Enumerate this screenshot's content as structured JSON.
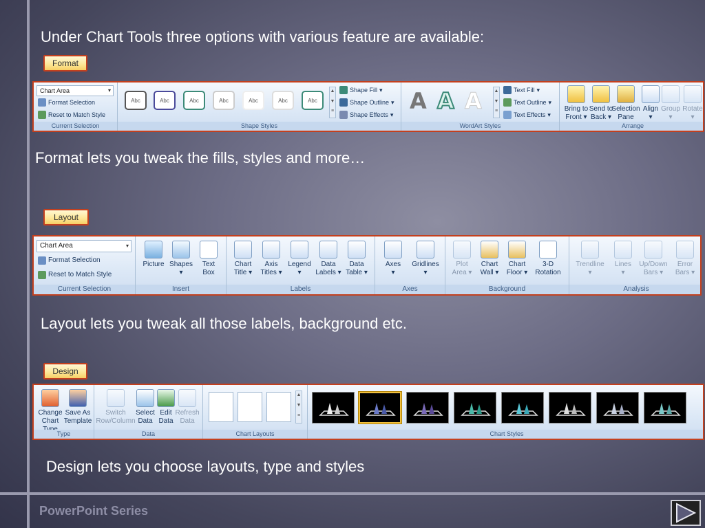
{
  "headings": {
    "intro": "Under Chart Tools three options with various feature are available:",
    "format_desc": "Format lets you tweak the fills, styles and more…",
    "layout_desc": "Layout lets you tweak all those labels, background etc.",
    "design_desc": "Design lets you choose layouts, type and styles"
  },
  "footer": "PowerPoint Series",
  "tabs": {
    "format": "Format",
    "layout": "Layout",
    "design": "Design"
  },
  "colors": {
    "tab_border": "#c4401e",
    "ribbon_label": "#3b5a82",
    "footer_text": "#8e8ea6"
  },
  "format_ribbon": {
    "chart_area": "Chart Area",
    "format_selection": "Format Selection",
    "reset_to_match_style": "Reset to Match Style",
    "current_selection": "Current Selection",
    "shape_swatch": "Abc",
    "shape_fill": "Shape Fill",
    "shape_outline": "Shape Outline",
    "shape_effects": "Shape Effects",
    "shape_styles": "Shape Styles",
    "wordart_letter": "A",
    "text_fill": "Text Fill",
    "text_outline": "Text Outline",
    "text_effects": "Text Effects",
    "wordart_styles": "WordArt Styles",
    "bring_to_front": [
      "Bring to",
      "Front ▾"
    ],
    "send_to_back": [
      "Send to",
      "Back ▾"
    ],
    "selection_pane": [
      "Selection",
      "Pane"
    ],
    "align": [
      "Align",
      "▾"
    ],
    "group": [
      "Group",
      "▾"
    ],
    "rotate": [
      "Rotate",
      "▾"
    ],
    "arrange": "Arrange"
  },
  "layout_ribbon": {
    "chart_area": "Chart Area",
    "format_selection": "Format Selection",
    "reset_to_match_style": "Reset to Match Style",
    "current_selection": "Current Selection",
    "picture": "Picture",
    "shapes": [
      "Shapes",
      "▾"
    ],
    "text_box": [
      "Text",
      "Box"
    ],
    "insert": "Insert",
    "chart_title": [
      "Chart",
      "Title ▾"
    ],
    "axis_titles": [
      "Axis",
      "Titles ▾"
    ],
    "legend": [
      "Legend",
      "▾"
    ],
    "data_labels": [
      "Data",
      "Labels ▾"
    ],
    "data_table": [
      "Data",
      "Table ▾"
    ],
    "labels": "Labels",
    "axes_btn": [
      "Axes",
      "▾"
    ],
    "gridlines": [
      "Gridlines",
      "▾"
    ],
    "axes": "Axes",
    "plot_area": [
      "Plot",
      "Area ▾"
    ],
    "chart_wall": [
      "Chart",
      "Wall ▾"
    ],
    "chart_floor": [
      "Chart",
      "Floor ▾"
    ],
    "rotation_3d": [
      "3-D",
      "Rotation"
    ],
    "background": "Background",
    "trendline": [
      "Trendline",
      "▾"
    ],
    "lines": [
      "Lines",
      "▾"
    ],
    "up_down_bars": [
      "Up/Down",
      "Bars ▾"
    ],
    "error_bars": [
      "Error",
      "Bars ▾"
    ],
    "analysis": "Analysis"
  },
  "design_ribbon": {
    "change_chart_type": [
      "Change",
      "Chart Type"
    ],
    "save_as_template": [
      "Save As",
      "Template"
    ],
    "type": "Type",
    "switch_row_column": [
      "Switch",
      "Row/Column"
    ],
    "select_data": [
      "Select",
      "Data"
    ],
    "edit_data": [
      "Edit",
      "Data"
    ],
    "refresh_data": [
      "Refresh",
      "Data"
    ],
    "data": "Data",
    "chart_layouts": "Chart Layouts",
    "chart_styles": "Chart Styles"
  }
}
